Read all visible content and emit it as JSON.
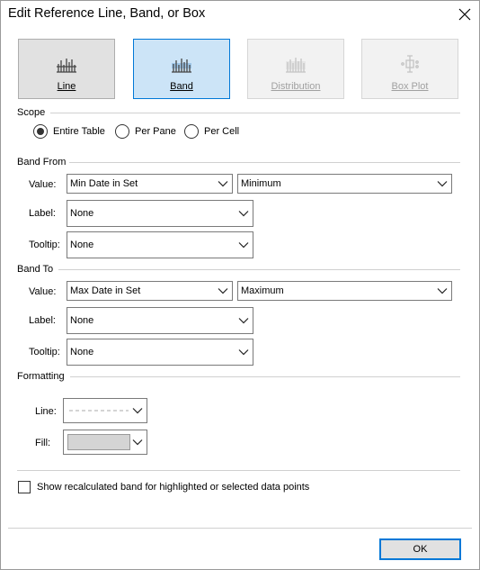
{
  "window": {
    "title": "Edit Reference Line, Band, or Box"
  },
  "types": [
    {
      "label": "Line",
      "state": "normal"
    },
    {
      "label": "Band",
      "state": "selected"
    },
    {
      "label": "Distribution",
      "state": "disabled"
    },
    {
      "label": "Box Plot",
      "state": "disabled"
    }
  ],
  "scope": {
    "heading": "Scope",
    "options": [
      "Entire Table",
      "Per Pane",
      "Per Cell"
    ],
    "selected": "Entire Table"
  },
  "band_from": {
    "heading": "Band From",
    "value_label": "Value:",
    "value": "Min Date in Set",
    "aggregation": "Minimum",
    "label_label": "Label:",
    "label": "None",
    "tooltip_label": "Tooltip:",
    "tooltip": "None"
  },
  "band_to": {
    "heading": "Band To",
    "value_label": "Value:",
    "value": "Max Date in Set",
    "aggregation": "Maximum",
    "label_label": "Label:",
    "label": "None",
    "tooltip_label": "Tooltip:",
    "tooltip": "None"
  },
  "formatting": {
    "heading": "Formatting",
    "line_label": "Line:",
    "fill_label": "Fill:",
    "fill_color": "#d4d4d4"
  },
  "recalc": {
    "label": "Show recalculated band for highlighted or selected data points",
    "checked": false
  },
  "footer": {
    "ok_label": "OK"
  },
  "colors": {
    "accent": "#0078d7",
    "selected_bg": "#cce4f7"
  }
}
